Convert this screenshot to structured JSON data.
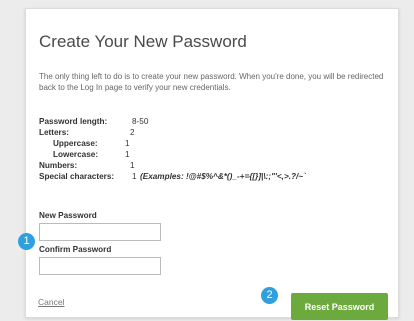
{
  "page": {
    "title": "Create Your New Password",
    "intro": "The only thing left to do is to create your new password. When you're done, you will be redirected back to the Log In page to verify your new credentials."
  },
  "requirements": {
    "length_label": "Password length:",
    "length_value": "8-50",
    "letters_label": "Letters:",
    "letters_value": "2",
    "uppercase_label": "Uppercase:",
    "uppercase_value": "1",
    "lowercase_label": "Lowercase:",
    "lowercase_value": "1",
    "numbers_label": "Numbers:",
    "numbers_value": "1",
    "special_label": "Special characters:",
    "special_value": "1",
    "special_examples": "(Examples: !@#$%^&*()_-+={[}]|\\:;\"'<,>.?/~`"
  },
  "form": {
    "new_password_label": "New Password",
    "new_password_value": "",
    "confirm_password_label": "Confirm Password",
    "confirm_password_value": ""
  },
  "actions": {
    "cancel_label": "Cancel",
    "reset_label": "Reset Password"
  },
  "badges": {
    "step1": "1",
    "step2": "2"
  },
  "colors": {
    "badge": "#2f9fdd",
    "reset_button": "#6daa3e"
  }
}
